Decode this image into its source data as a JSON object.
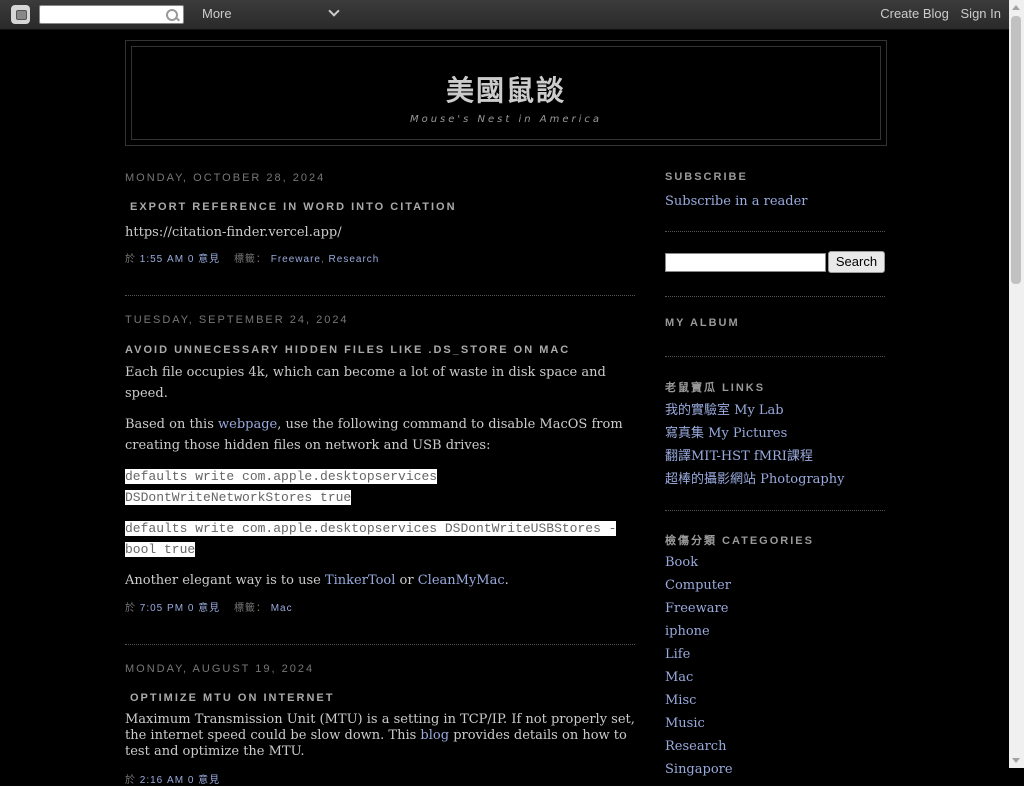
{
  "navbar": {
    "more_label": "More",
    "create_blog": "Create Blog",
    "sign_in": "Sign In"
  },
  "header": {
    "title": "美國鼠談",
    "description": "Mouse's Nest in America"
  },
  "posts": [
    {
      "date": "Monday, October 28, 2024",
      "title": "Export reference in Word into Citation",
      "body": "https://citation-finder.vercel.app/",
      "footer": {
        "prefix": "於",
        "time": "1:55 AM",
        "comments": "0 意見",
        "labels_prefix": "標籤：",
        "labels": [
          "Freeware",
          "Research"
        ]
      }
    },
    {
      "date": "Tuesday, September 24, 2024",
      "title": "Avoid unnecessary hidden files like .DS_Store on Mac",
      "p1": "Each file occupies 4k, which can become a lot of waste in disk space and speed.",
      "p2_pre": "Based on this ",
      "p2_link": "webpage",
      "p2_post": ", use the following command to disable MacOS from creating those hidden files on network and USB drives:",
      "code1_a": "defaults write com.apple.desktopservices",
      "code1_b": "DSDontWriteNetworkStores true",
      "code2_a": "defaults write com.apple.desktopservices DSDontWriteUSBStores -",
      "code2_b": "bool true",
      "p3_pre": "Another elegant way is to use ",
      "p3_link1": "TinkerTool",
      "p3_mid": " or ",
      "p3_link2": "CleanMyMac",
      "p3_post": ".",
      "footer": {
        "prefix": "於",
        "time": "7:05 PM",
        "comments": "0 意見",
        "labels_prefix": "標籤：",
        "labels": [
          "Mac"
        ]
      }
    },
    {
      "date": "Monday, August 19, 2024",
      "title": "Optimize MTU on Internet",
      "p1_pre": "Maximum Transmission Unit (MTU) is a setting in TCP/IP. If not properly set, the internet speed could be slow down. This ",
      "p1_link": "blog",
      "p1_post": " provides details on how to test and optimize the MTU.",
      "footer": {
        "prefix": "於",
        "time": "2:16 AM",
        "comments": "0 意見"
      }
    }
  ],
  "sidebar": {
    "subscribe_title": "Subscribe",
    "subscribe_link": "Subscribe in a reader",
    "search_button": "Search",
    "album_title": "My Album",
    "links_title": "老鼠寶瓜 Links",
    "links": [
      "我的實驗室 My Lab",
      "寫真集 My Pictures",
      "翻譯MIT-HST fMRI課程",
      "超棒的攝影網站 Photography"
    ],
    "categories_title": "檢傷分類 Categories",
    "categories": [
      "Book",
      "Computer",
      "Freeware",
      "iphone",
      "Life",
      "Mac",
      "Misc",
      "Music",
      "Research",
      "Singapore"
    ]
  }
}
